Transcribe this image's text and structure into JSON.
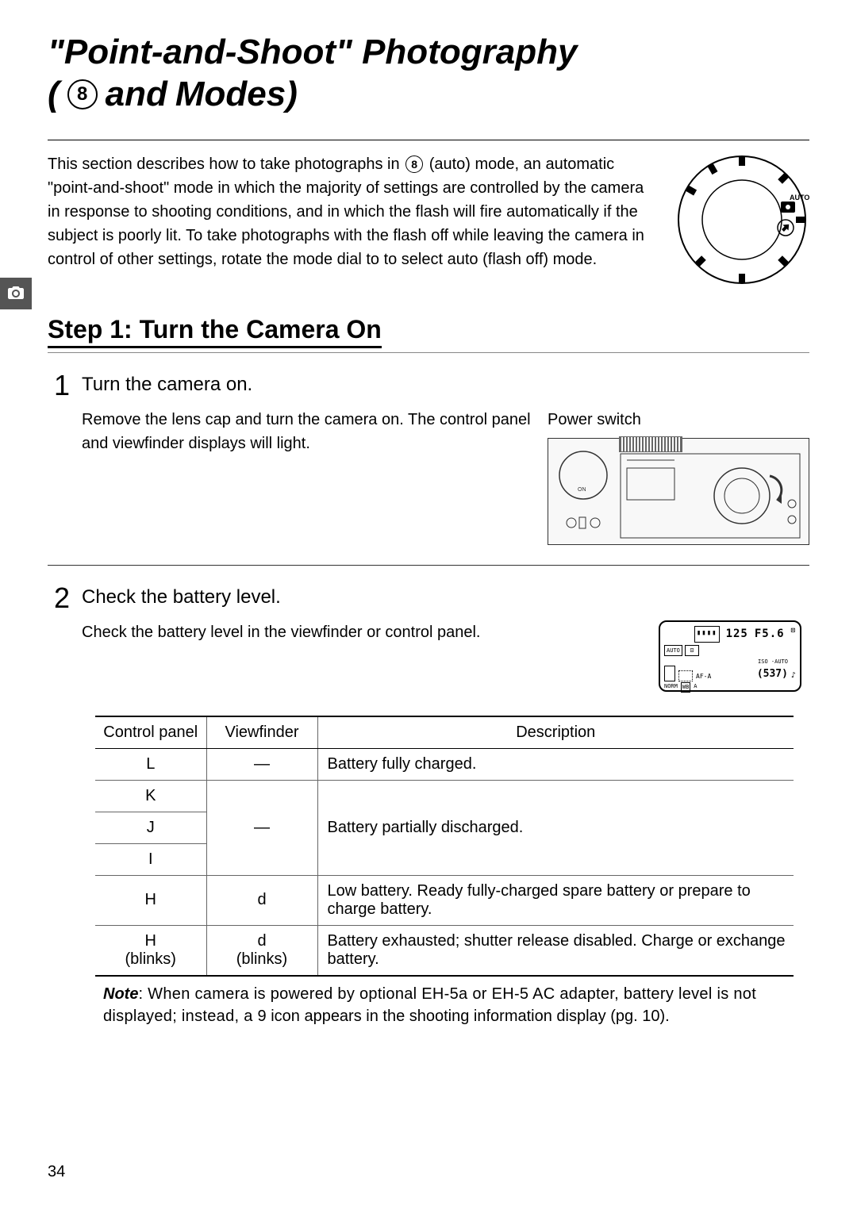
{
  "title": {
    "line1": "\"Point-and-Shoot\" Photography",
    "open_paren": "(",
    "icon_glyph": "8",
    "and": " and ",
    "modes_close": "Modes)"
  },
  "intro": {
    "text_before_icon": "This section describes how to take photographs in ",
    "icon_glyph": "8",
    "text_after_icon": " (auto) mode, an automatic \"point-and-shoot\" mode in which the majority of settings are controlled by the camera in response to shooting conditions, and in which the flash will fire automatically if the subject is poorly lit.  To take photographs with the flash off while leaving the camera in control of other settings, rotate the mode dial to      to select auto (flash off) mode."
  },
  "mode_dial_label": "AUTO",
  "section_heading": "Step 1: Turn the Camera On",
  "steps": [
    {
      "number": "1",
      "title": "Turn the camera on.",
      "text": "Remove the lens cap and turn the camera on.  The control panel and viewfinder displays will light.",
      "image_label": "Power switch"
    },
    {
      "number": "2",
      "title": "Check the battery level.",
      "text": "Check the battery level in the viewfinder or control panel."
    }
  ],
  "lcd": {
    "shutter": "125",
    "aperture": "F5.6",
    "auto_label": "AUTO",
    "af": "AF-A",
    "iso": "ISO -AUTO",
    "norm": "NORM",
    "wb_a": "WB   A",
    "frames": "537"
  },
  "table": {
    "headers": [
      "Control panel",
      "Viewfinder",
      "Description"
    ],
    "rows": [
      {
        "cp": "L",
        "vf": "—",
        "desc": "Battery fully charged.",
        "rowspan_vf": 1
      },
      {
        "cp": "K",
        "vf": "—",
        "desc": "Battery partially discharged."
      },
      {
        "cp": "J"
      },
      {
        "cp": "I"
      },
      {
        "cp": "H",
        "vf": "d",
        "desc": "Low battery.  Ready fully-charged spare battery or prepare to charge battery."
      },
      {
        "cp": "H\n(blinks)",
        "vf": "d\n(blinks)",
        "desc": "Battery exhausted; shutter release disabled.  Charge or exchange battery."
      }
    ],
    "note_label": "Note",
    "note_text_before9": ": When camera is powered by optional EH-5a or EH-5 AC adapter, battery level is not displayed; instead, a ",
    "note_9": "9",
    "note_text_after9": " icon appears in the shooting information display (pg. 10)."
  },
  "page_number": "34"
}
